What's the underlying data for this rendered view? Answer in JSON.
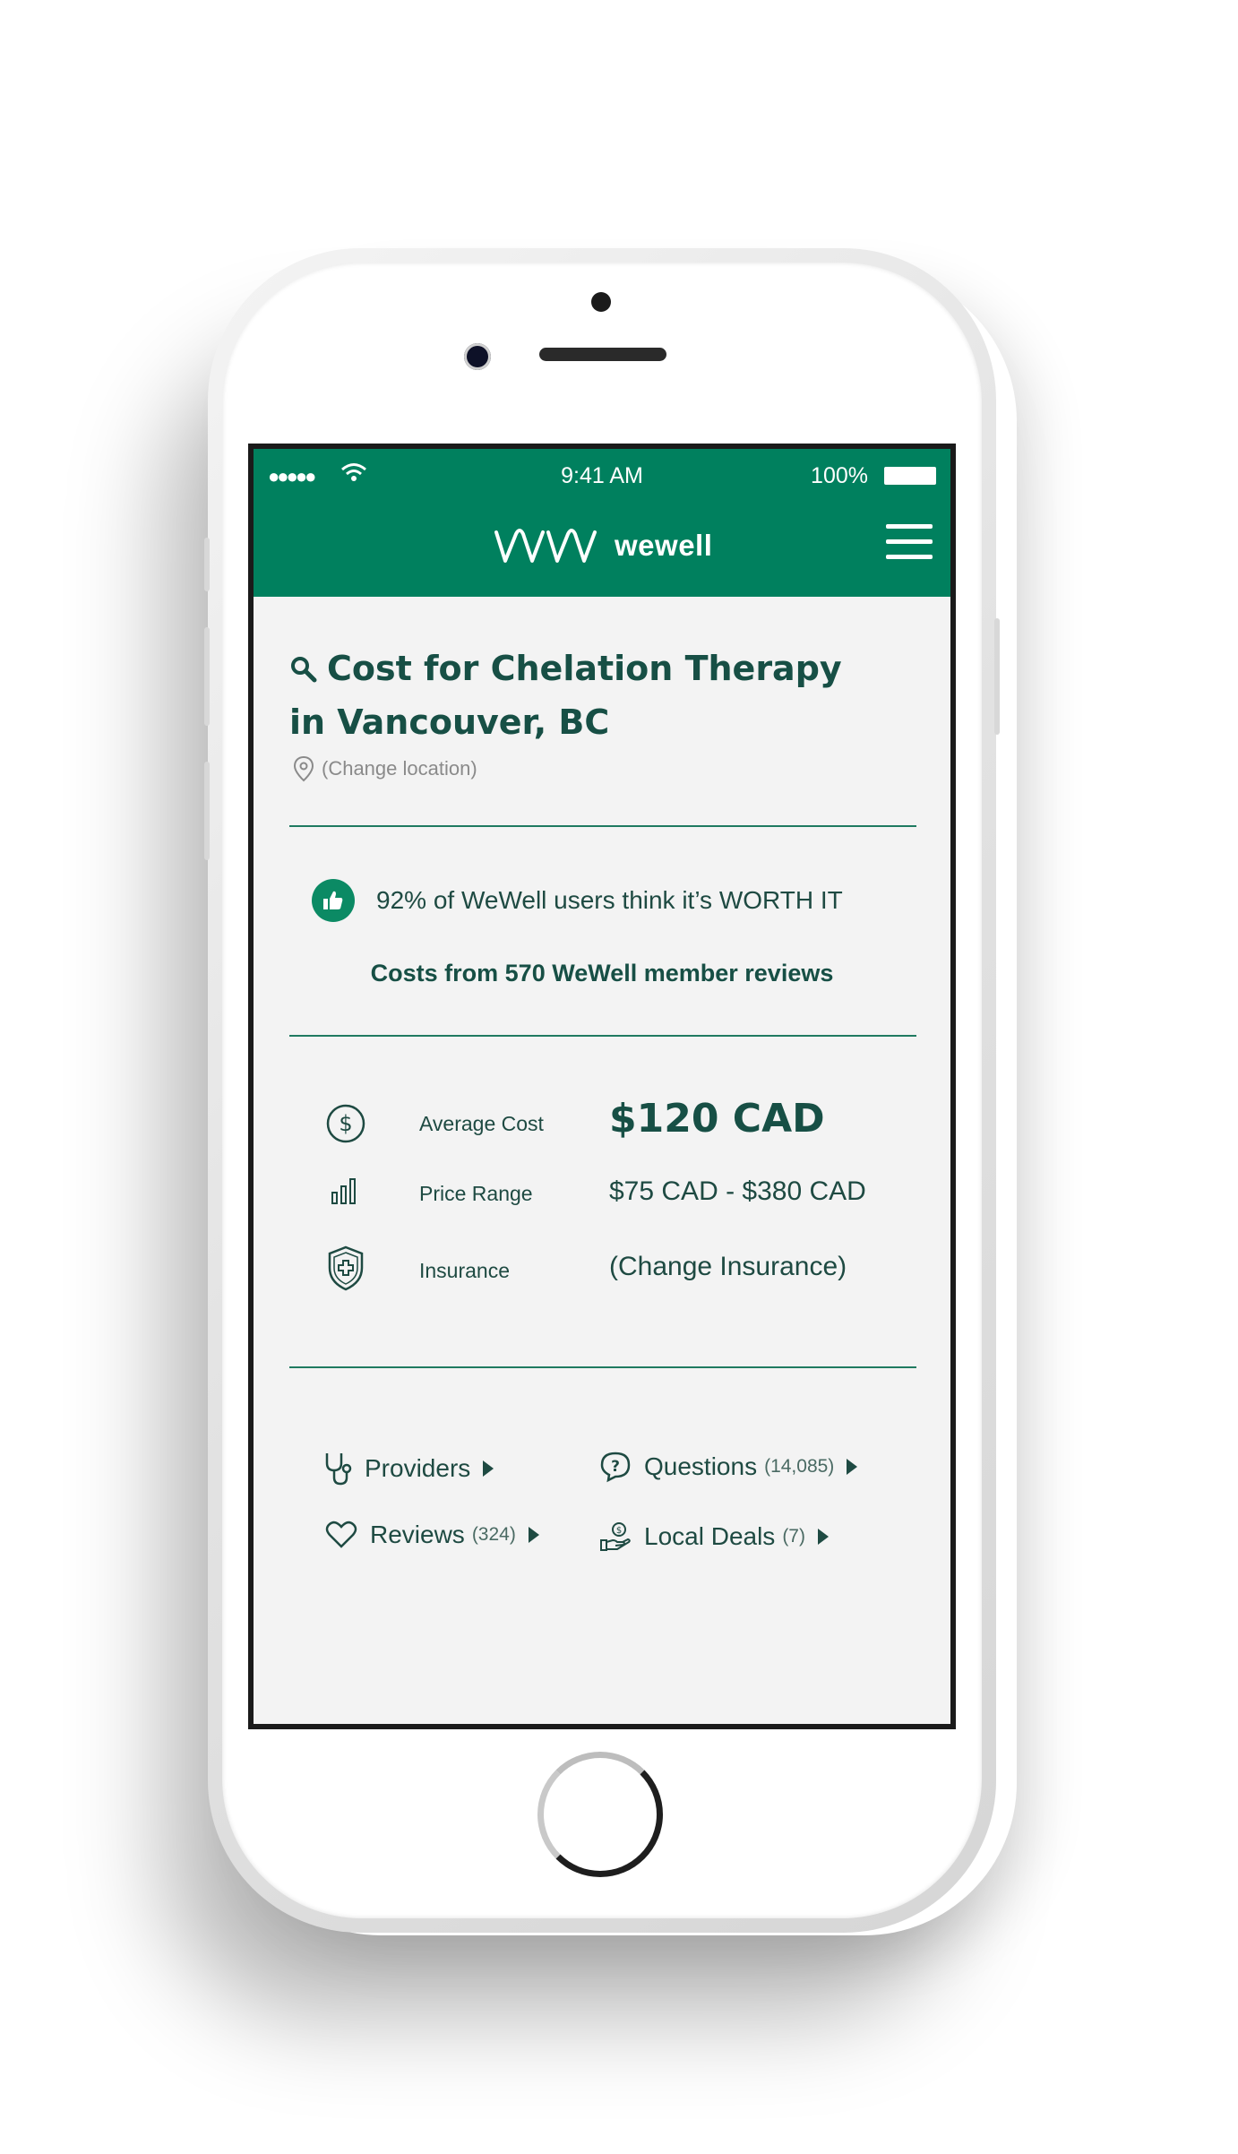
{
  "status_bar": {
    "signal": "●●●●●",
    "time": "9:41 AM",
    "battery": "100%"
  },
  "header": {
    "logo_text": "wewell",
    "menu_icon": "hamburger-menu-icon"
  },
  "search": {
    "title_line1": "Cost for Chelation Therapy",
    "title_line2": "in Vancouver, BC",
    "change_location": "(Change location)"
  },
  "summary": {
    "worth_it": "92% of  WeWell users think it’s WORTH IT",
    "reviews_line": "Costs from 570 WeWell member reviews"
  },
  "costs": {
    "average_label": "Average Cost",
    "average_value": "$120 CAD",
    "range_label": "Price Range",
    "range_value": "$75 CAD - $380 CAD",
    "insurance_label": "Insurance",
    "insurance_value": "(Change Insurance)"
  },
  "links": {
    "providers": {
      "label": "Providers"
    },
    "questions": {
      "label": "Questions",
      "count": "(14,085)"
    },
    "reviews": {
      "label": "Reviews",
      "count": "(324)"
    },
    "deals": {
      "label": "Local Deals",
      "count": "(7)"
    }
  },
  "colors": {
    "brand_green": "#00805e",
    "text_dark_green": "#174f45"
  }
}
